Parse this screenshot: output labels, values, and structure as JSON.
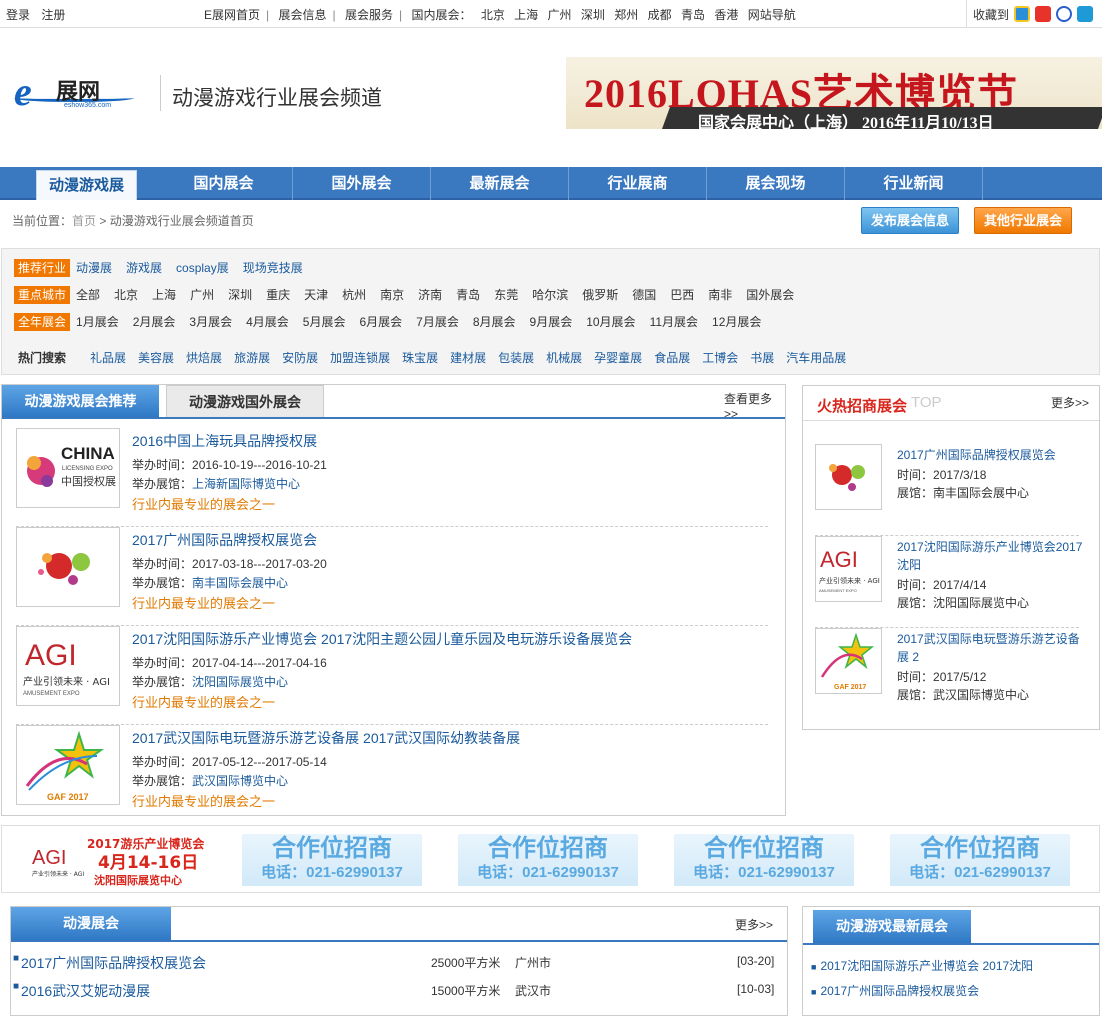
{
  "topbar": {
    "login": "登录",
    "register": "注册",
    "links": [
      "E展网首页",
      "展会信息",
      "展会服务",
      "国内展会："
    ],
    "cities": [
      "北京",
      "上海",
      "广州",
      "深圳",
      "郑州",
      "成都",
      "青岛",
      "香港",
      "网站导航"
    ],
    "bookmark_label": "收藏到",
    "bookmark_icons": [
      {
        "name": "qq-bookmark-icon",
        "color": "#2a8fd8"
      },
      {
        "name": "sina-bookmark-icon",
        "color": "#e8332a"
      },
      {
        "name": "baidu-bookmark-icon",
        "color": "#2b5fd0"
      },
      {
        "name": "other-bookmark-icon",
        "color": "#1e9ad6"
      }
    ]
  },
  "header": {
    "logo_main": "展网",
    "logo_sub": "eshow365.com",
    "channel_title": "动漫游戏行业展会频道",
    "banner_title": "2016LOHAS艺术博览节",
    "banner_sub": "国家会展中心（上海）  2016年11月10/13日"
  },
  "nav": {
    "items": [
      "动漫游戏展",
      "国内展会",
      "国外展会",
      "最新展会",
      "行业展商",
      "展会现场",
      "行业新闻"
    ]
  },
  "breadcrumb": {
    "label": "当前位置：",
    "home": "首页",
    "current": " > 动漫游戏行业展会频道首页"
  },
  "buttons": {
    "publish": "发布展会信息",
    "other": "其他行业展会"
  },
  "filter": {
    "industry_label": "推荐行业",
    "industries": [
      "动漫展",
      "游戏展",
      "cosplay展",
      "现场竞技展"
    ],
    "city_label": "重点城市",
    "cities": [
      "全部",
      "北京",
      "上海",
      "广州",
      "深圳",
      "重庆",
      "天津",
      "杭州",
      "南京",
      "济南",
      "青岛",
      "东莞",
      "哈尔滨",
      "俄罗斯",
      "德国",
      "巴西",
      "南非",
      "国外展会"
    ],
    "month_label": "全年展会",
    "months": [
      "1月展会",
      "2月展会",
      "3月展会",
      "4月展会",
      "5月展会",
      "6月展会",
      "7月展会",
      "8月展会",
      "9月展会",
      "10月展会",
      "11月展会",
      "12月展会"
    ],
    "hot_label": "热门搜索",
    "hot": [
      "礼品展",
      "美容展",
      "烘焙展",
      "旅游展",
      "安防展",
      "加盟连锁展",
      "珠宝展",
      "建材展",
      "包装展",
      "机械展",
      "孕婴童展",
      "食品展",
      "工博会",
      "书展",
      "汽车用品展"
    ]
  },
  "recommend": {
    "tab1": "动漫游戏展会推荐",
    "tab2": "动漫游戏国外展会",
    "more": "查看更多>>",
    "time_label": "举办时间：",
    "venue_label": "举办展馆：",
    "items": [
      {
        "title": "2016中国上海玩具品牌授权展",
        "time": "2016-10-19---2016-10-21",
        "venue": "上海新国际博览中心",
        "tag": "行业内最专业的展会之一",
        "thumb_text": "CHINA"
      },
      {
        "title": "2017广州国际品牌授权展览会",
        "time": "2017-03-18---2017-03-20",
        "venue": "南丰国际会展中心",
        "tag": "行业内最专业的展会之一",
        "thumb_text": ""
      },
      {
        "title": "2017沈阳国际游乐产业博览会  2017沈阳主题公园儿童乐园及电玩游乐设备展览会",
        "time": "2017-04-14---2017-04-16",
        "venue": "沈阳国际展览中心",
        "tag": "行业内最专业的展会之一",
        "thumb_text": "AGI"
      },
      {
        "title": "2017武汉国际电玩暨游乐游艺设备展  2017武汉国际幼教装备展",
        "time": "2017-05-12---2017-05-14",
        "venue": "武汉国际博览中心",
        "tag": "行业内最专业的展会之一",
        "thumb_text": "GAF 2017"
      }
    ],
    "thumb_sub": {
      "china": "LICENSING EXPO",
      "china_cn": "中国授权展",
      "agi_cn": "产业引领未来 · AGI",
      "agi_en": "AMUSEMENT EXPO"
    }
  },
  "hot": {
    "title": "火热招商展会",
    "top": "TOP",
    "more": "更多>>",
    "time_label": "时间：",
    "venue_label": "展馆：",
    "items": [
      {
        "title": "2017广州国际品牌授权展览会",
        "time": "2017/3/18",
        "venue": "南丰国际会展中心"
      },
      {
        "title": "2017沈阳国际游乐产业博览会2017沈阳",
        "time": "2017/4/14",
        "venue": "沈阳国际展览中心"
      },
      {
        "title": "2017武汉国际电玩暨游乐游艺设备展 2",
        "time": "2017/5/12",
        "venue": "武汉国际博览中心"
      }
    ]
  },
  "ads": {
    "agi_title": "2017游乐产业博览会",
    "agi_date": "4月14-16日",
    "agi_venue": "沈阳国际展览中心",
    "agi_logo": "AGI",
    "agi_logo_sub": "产业引领未来 · AGI",
    "slot_title": "合作位招商",
    "slot_phone": "电话：021-62990137"
  },
  "anime": {
    "tab": "动漫展会",
    "more": "更多>>",
    "rows": [
      {
        "title": "2017广州国际品牌授权展览会",
        "area": "25000平方米",
        "city": "广州市",
        "date": "[03-20]"
      },
      {
        "title": "2016武汉艾妮动漫展",
        "area": "15000平方米",
        "city": "武汉市",
        "date": "[10-03]"
      }
    ]
  },
  "latest": {
    "tab": "动漫游戏最新展会",
    "rows": [
      "2017沈阳国际游乐产业博览会 2017沈阳",
      "2017广州国际品牌授权展览会"
    ]
  }
}
